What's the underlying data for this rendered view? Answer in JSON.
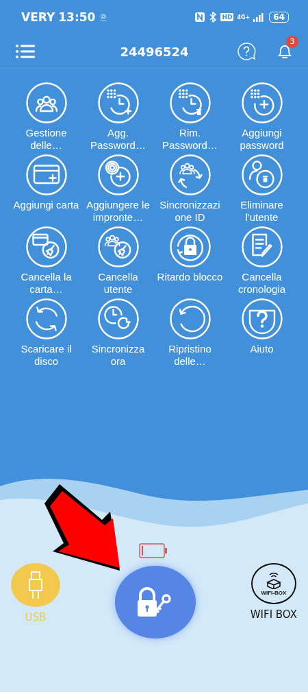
{
  "status_bar": {
    "carrier": "VERY",
    "time": "13:50",
    "hd": "HD",
    "network": "4G+",
    "battery": "64"
  },
  "top_bar": {
    "title": "24496524",
    "notifications": "3"
  },
  "actions": [
    {
      "label": "Gestione delle…"
    },
    {
      "label": "Agg. Password…"
    },
    {
      "label": "Rim. Password…"
    },
    {
      "label": "Aggiungi password"
    },
    {
      "label": "Aggiungi carta"
    },
    {
      "label": "Aggiungere le impronte…"
    },
    {
      "label": "Sincronizzazi one ID"
    },
    {
      "label": "Eliminare l'utente"
    },
    {
      "label": "Cancella la carta…"
    },
    {
      "label": "Cancella utente"
    },
    {
      "label": "Ritardo blocco"
    },
    {
      "label": "Cancella cronologia"
    },
    {
      "label": "Scaricare il disco"
    },
    {
      "label": "Sincronizza ora"
    },
    {
      "label": "Ripristino delle…"
    },
    {
      "label": "Aiuto"
    }
  ],
  "bottom": {
    "usb": {
      "label": "USB"
    },
    "wifi_box": {
      "badge": "WIFI-BOX",
      "label": "WIFI BOX"
    }
  }
}
